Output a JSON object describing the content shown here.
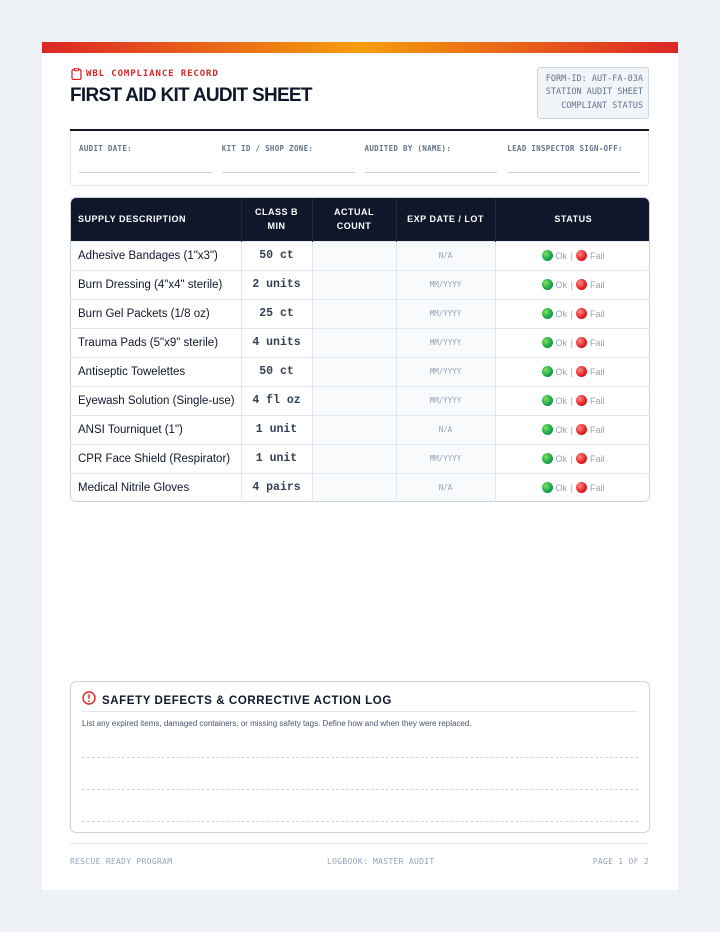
{
  "header": {
    "kicker": "WBL COMPLIANCE RECORD",
    "title": "FIRST AID KIT AUDIT SHEET",
    "form_box": [
      "FORM-ID: AUT-FA-03A",
      "STATION AUDIT SHEET",
      "COMPLIANT STATUS"
    ]
  },
  "meta_fields": [
    {
      "label": "AUDIT DATE:",
      "value": ""
    },
    {
      "label": "KIT ID / SHOP ZONE:",
      "value": ""
    },
    {
      "label": "AUDITED BY (NAME):",
      "value": ""
    },
    {
      "label": "LEAD INSPECTOR SIGN-OFF:",
      "value": ""
    }
  ],
  "table": {
    "columns": {
      "description": "SUPPLY DESCRIPTION",
      "class_b_min": [
        "CLASS B",
        "MIN"
      ],
      "actual_count": [
        "ACTUAL",
        "COUNT"
      ],
      "exp_date_lot": "EXP DATE / LOT",
      "status": "STATUS"
    },
    "status_ok": "Ok",
    "status_fail": "Fail",
    "status_separator": "|",
    "rows": [
      {
        "description": "Adhesive Bandages (1\"x3\")",
        "min": "50 ct",
        "actual": "",
        "exp": "N/A"
      },
      {
        "description": "Burn Dressing (4\"x4\" sterile)",
        "min": "2 units",
        "actual": "",
        "exp": "MM/YYYY"
      },
      {
        "description": "Burn Gel Packets (1/8 oz)",
        "min": "25 ct",
        "actual": "",
        "exp": "MM/YYYY"
      },
      {
        "description": "Trauma Pads (5\"x9\" sterile)",
        "min": "4 units",
        "actual": "",
        "exp": "MM/YYYY"
      },
      {
        "description": "Antiseptic Towelettes",
        "min": "50 ct",
        "actual": "",
        "exp": "MM/YYYY"
      },
      {
        "description": "Eyewash Solution (Single-use)",
        "min": "4 fl oz",
        "actual": "",
        "exp": "MM/YYYY"
      },
      {
        "description": "ANSI Tourniquet (1\")",
        "min": "1 unit",
        "actual": "",
        "exp": "N/A"
      },
      {
        "description": "CPR Face Shield (Respirator)",
        "min": "1 unit",
        "actual": "",
        "exp": "MM/YYYY"
      },
      {
        "description": "Medical Nitrile Gloves",
        "min": "4 pairs",
        "actual": "",
        "exp": "N/A"
      }
    ]
  },
  "defects": {
    "title": "SAFETY DEFECTS & CORRECTIVE ACTION LOG",
    "description": "List any expired items, damaged containers, or missing safety tags. Define how and when they were replaced."
  },
  "footer": {
    "left": "RESCUE READY PROGRAM",
    "center": "LOGBOOK: MASTER AUDIT",
    "right": "PAGE 1 OF 2"
  },
  "colors": {
    "accent_red": "#dc2626",
    "accent_amber": "#f59e0b",
    "header_navy": "#0f172a",
    "status_ok": "#16a34a",
    "status_fail": "#e11d1d"
  },
  "icons": {
    "kicker": "clipboard-icon",
    "defects": "alert-circle-icon",
    "status_ok": "green-dot-icon",
    "status_fail": "red-dot-icon"
  }
}
